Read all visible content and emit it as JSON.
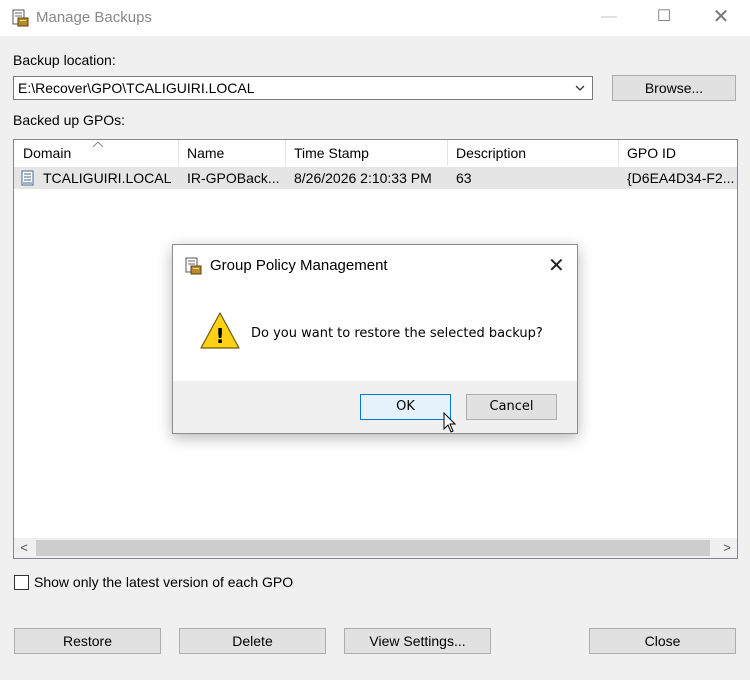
{
  "window": {
    "title": "Manage Backups",
    "minimize": "—",
    "maximize": "☐",
    "close": "✕"
  },
  "backup_location": {
    "label": "Backup location:",
    "value": "E:\\Recover\\GPO\\TCALIGUIRI.LOCAL",
    "browse_label": "Browse..."
  },
  "backed_up": {
    "label": "Backed up GPOs:",
    "columns": [
      "Domain",
      "Name",
      "Time Stamp",
      "Description",
      "GPO ID"
    ],
    "rows": [
      {
        "domain": "TCALIGUIRI.LOCAL",
        "name": "IR-GPOBack...",
        "timestamp": "8/26/2026 2:10:33 PM",
        "description": "63",
        "gpo_id": "{D6EA4D34-F2..."
      }
    ],
    "scroll_left": "<",
    "scroll_right": ">"
  },
  "show_latest": {
    "label": "Show only the latest version of each GPO",
    "checked": false
  },
  "buttons": {
    "restore": "Restore",
    "delete": "Delete",
    "view_settings": "View Settings...",
    "close": "Close"
  },
  "dialog": {
    "title": "Group Policy Management",
    "close": "✕",
    "icon_glyph": "!",
    "message": "Do you want to restore the selected backup?",
    "ok_label": "OK",
    "cancel_label": "Cancel"
  },
  "colors": {
    "accent": "#0078d7",
    "warning": "#fcd116",
    "selected_row": "#e5e5e5"
  },
  "icons": [
    "gpo-app-icon",
    "dropdown-chevron-icon",
    "sort-up-icon",
    "backup-document-icon",
    "warning-icon",
    "mouse-cursor-icon"
  ]
}
